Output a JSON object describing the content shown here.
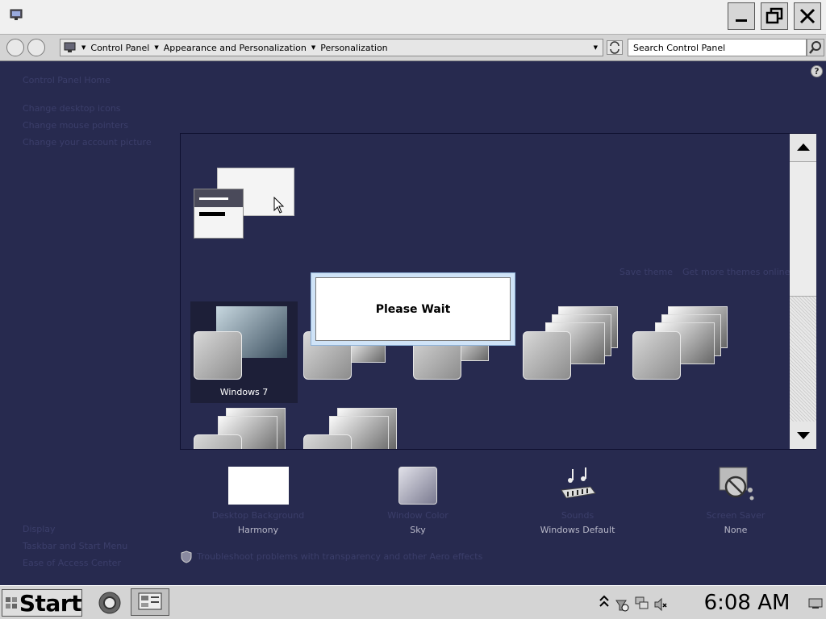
{
  "address_bar": {
    "breadcrumb": [
      "Control Panel",
      "Appearance and Personalization",
      "Personalization"
    ],
    "search_value": "Search Control Panel"
  },
  "sidebar": {
    "home": "Control Panel Home",
    "tasks": [
      "Change desktop icons",
      "Change mouse pointers",
      "Change your account picture"
    ],
    "see_also": [
      "Display",
      "Taskbar and Start Menu",
      "Ease of Access Center"
    ]
  },
  "themes": {
    "save_theme": "Save theme",
    "get_more": "Get more themes online",
    "selected_name": "Windows 7"
  },
  "bottom": {
    "items": [
      {
        "label": "Desktop Background",
        "value": "Harmony",
        "icon": "desktop-background-icon"
      },
      {
        "label": "Window Color",
        "value": "Sky",
        "icon": "window-color-icon"
      },
      {
        "label": "Sounds",
        "value": "Windows Default",
        "icon": "sounds-icon"
      },
      {
        "label": "Screen Saver",
        "value": "None",
        "icon": "screen-saver-icon"
      }
    ],
    "troubleshoot": "Troubleshoot problems with transparency and other Aero effects"
  },
  "dialog": {
    "message": "Please Wait"
  },
  "taskbar": {
    "start_label": "Start",
    "clock": "6:08 AM"
  }
}
